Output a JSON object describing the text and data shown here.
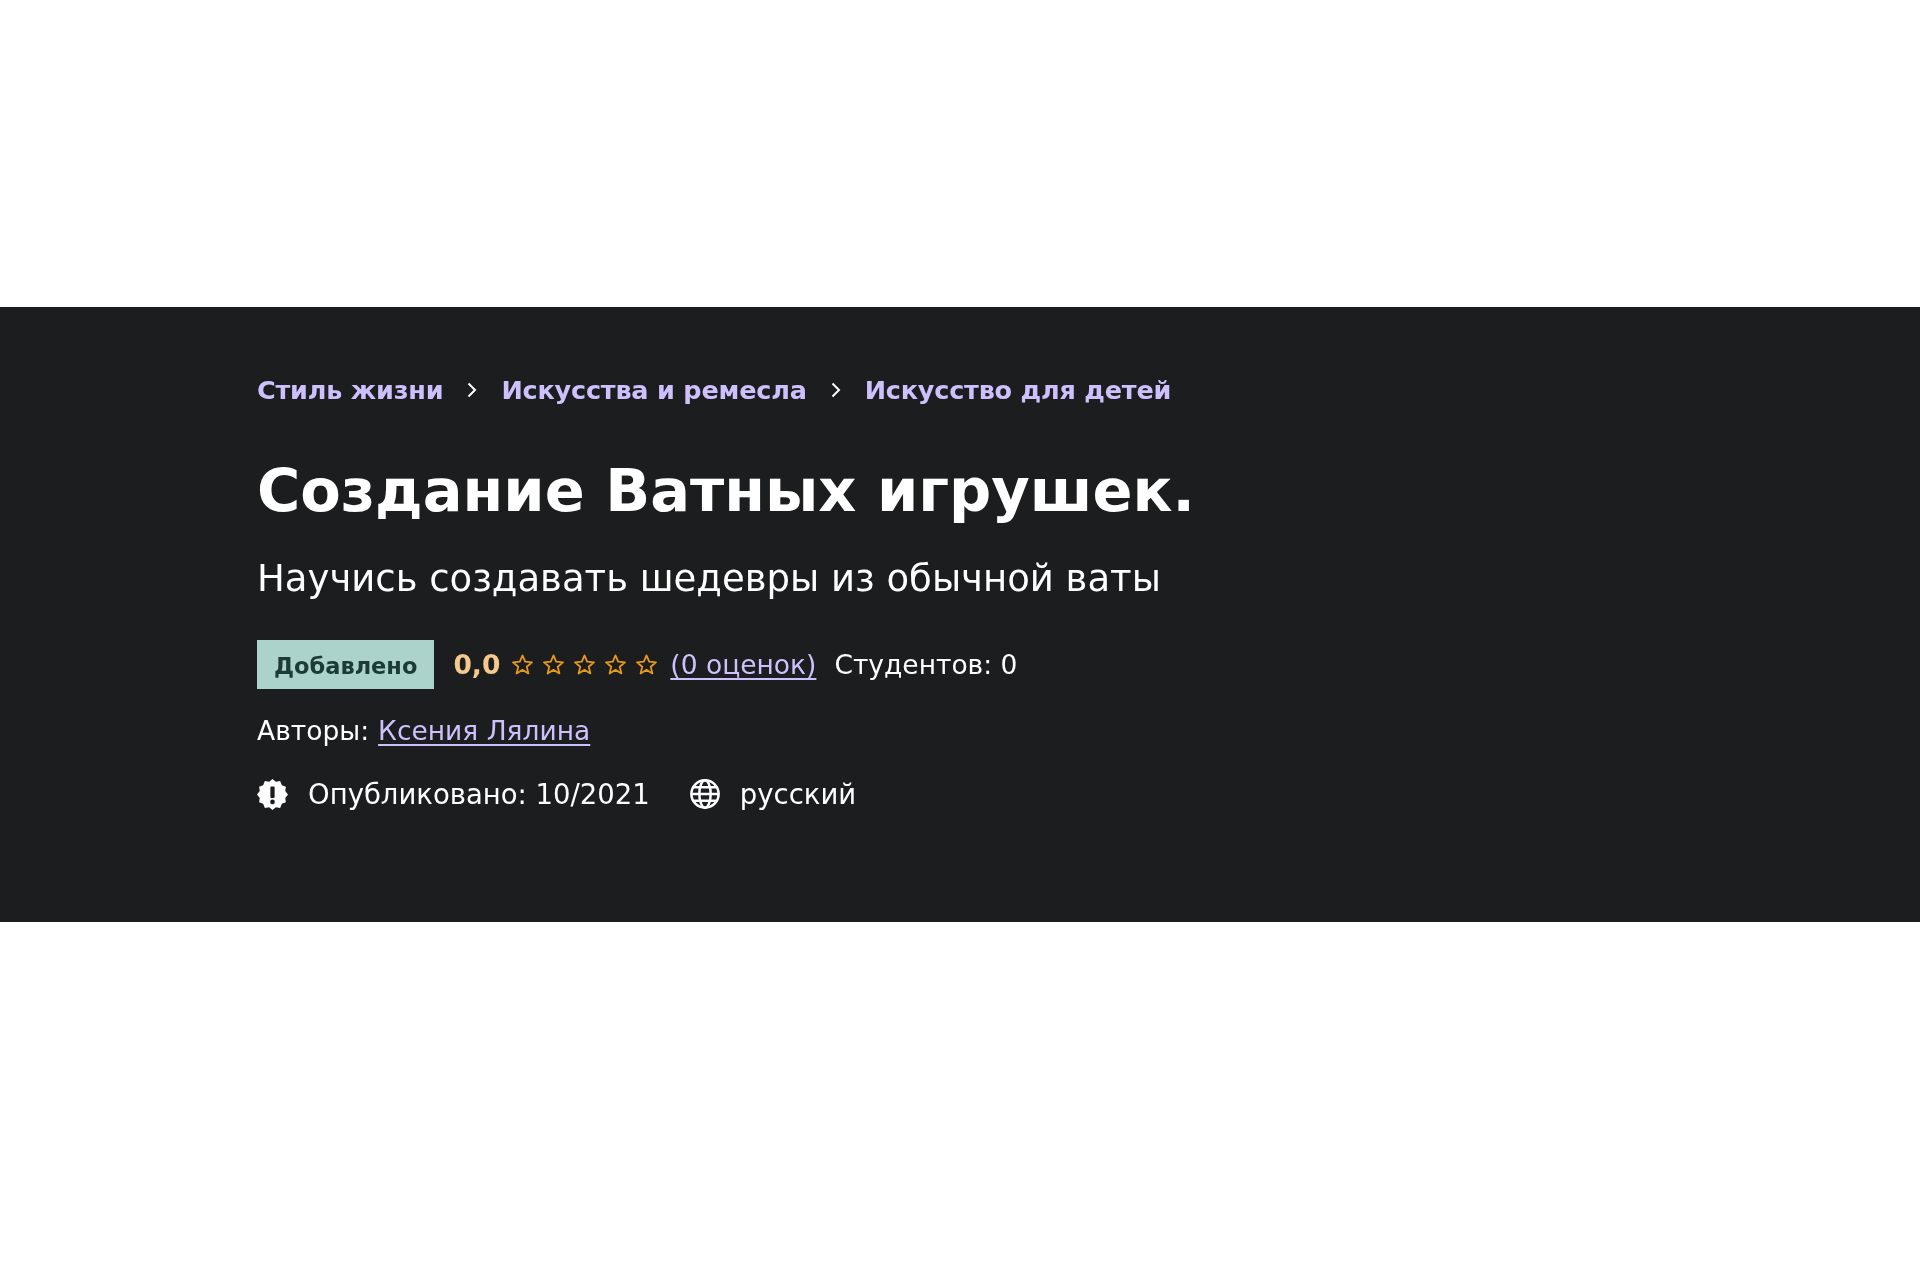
{
  "breadcrumbs": [
    {
      "label": "Стиль жизни"
    },
    {
      "label": "Искусства и ремесла"
    },
    {
      "label": "Искусство для детей"
    }
  ],
  "course": {
    "title": "Создание Ватных игрушек.",
    "subtitle": "Научись создавать шедевры из обычной ваты",
    "badge": "Добавлено",
    "rating": {
      "score": "0,0",
      "stars": 0,
      "count": "(0 оценок)"
    },
    "students": "Студентов: 0",
    "authors_label": "Авторы:",
    "authors": [
      {
        "name": "Ксения Лялина"
      }
    ],
    "published": "Опубликовано: 10/2021",
    "language": "русский"
  }
}
